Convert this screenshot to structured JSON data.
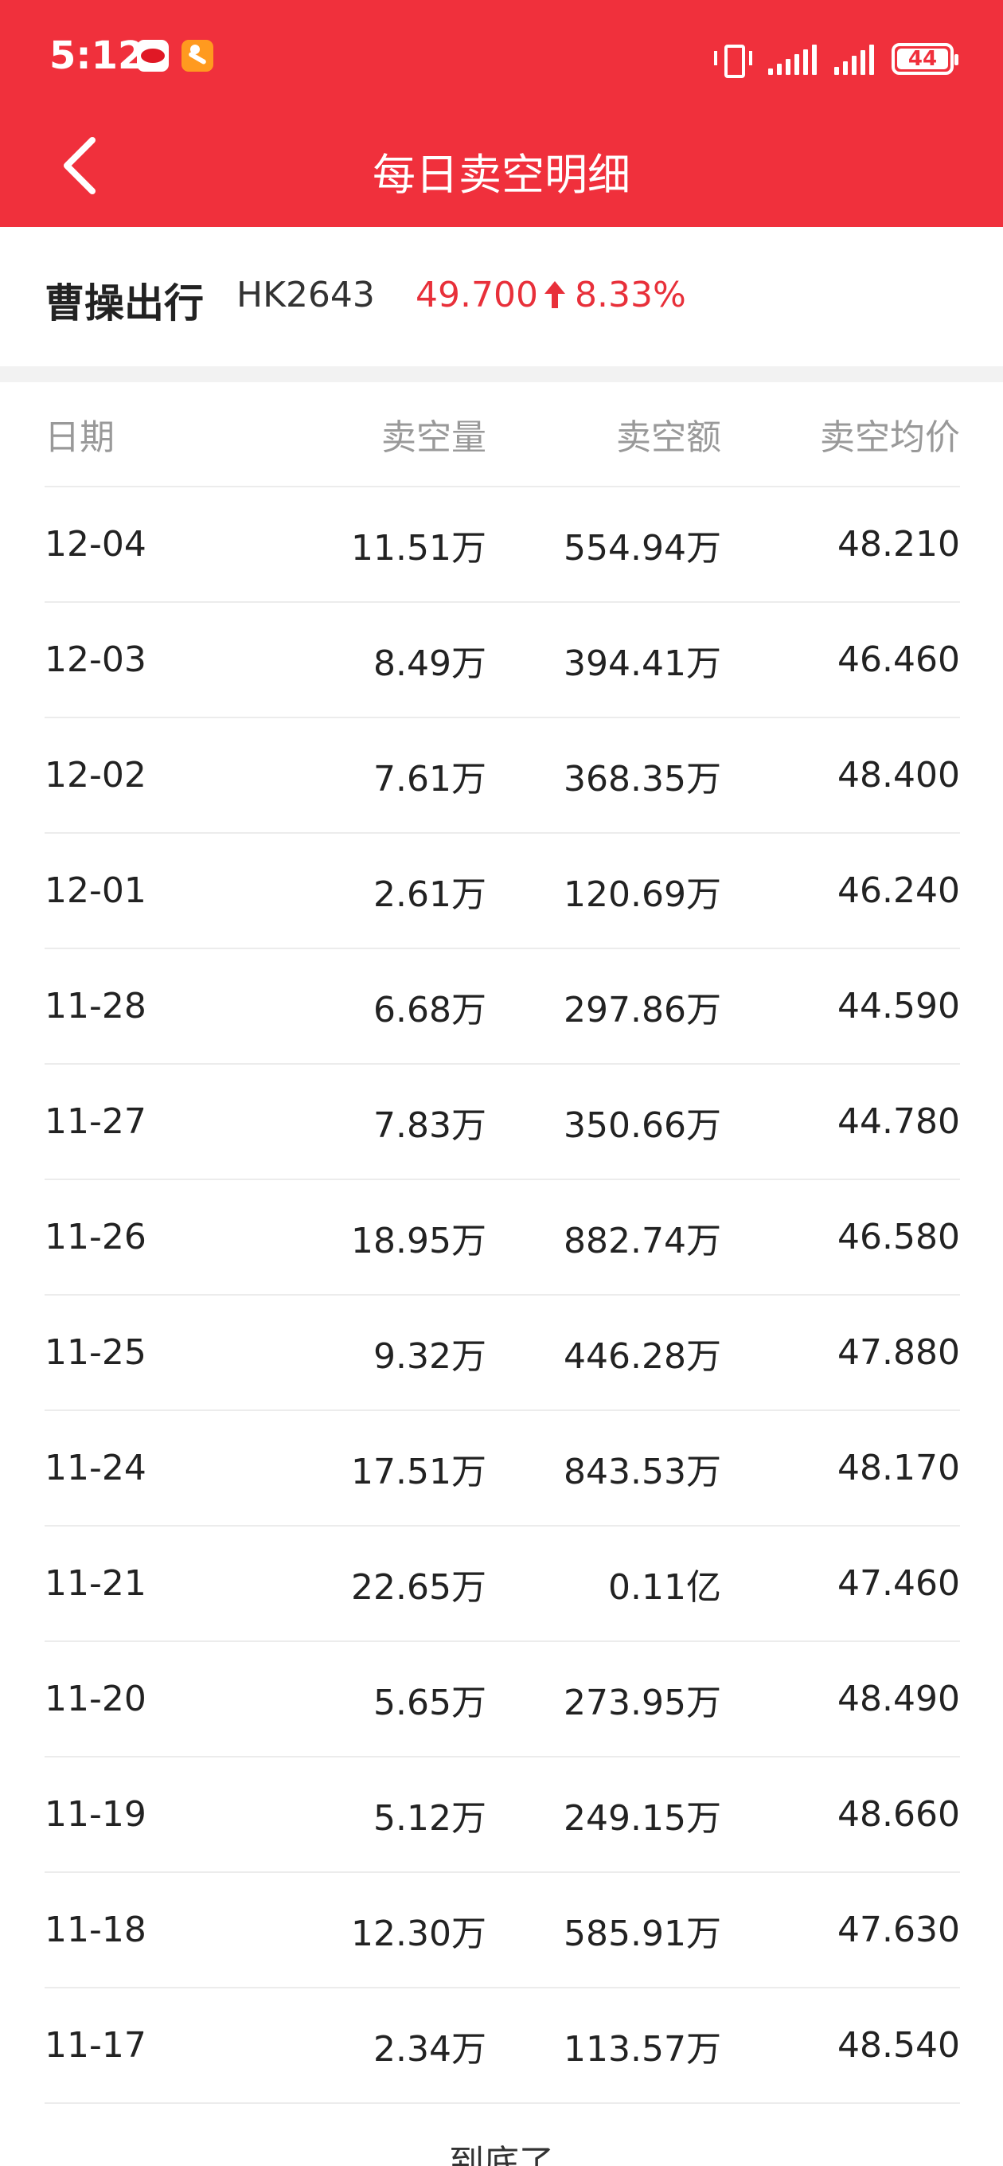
{
  "status_bar": {
    "time": "5:12",
    "battery": "44",
    "app_icons": [
      "byd-icon",
      "cc-app-icon"
    ]
  },
  "header": {
    "title": "每日卖空明细",
    "back_icon": "chevron-left-icon",
    "bg_color": "#f0303c"
  },
  "stock": {
    "name": "曹操出行",
    "code": "HK2643",
    "price": "49.700",
    "change": "8.33%",
    "direction_icon": "arrow-up-icon",
    "up_color": "#e8303a"
  },
  "table": {
    "headers": [
      "日期",
      "卖空量",
      "卖空额",
      "卖空均价"
    ],
    "rows": [
      [
        "12-04",
        "11.51万",
        "554.94万",
        "48.210"
      ],
      [
        "12-03",
        "8.49万",
        "394.41万",
        "46.460"
      ],
      [
        "12-02",
        "7.61万",
        "368.35万",
        "48.400"
      ],
      [
        "12-01",
        "2.61万",
        "120.69万",
        "46.240"
      ],
      [
        "11-28",
        "6.68万",
        "297.86万",
        "44.590"
      ],
      [
        "11-27",
        "7.83万",
        "350.66万",
        "44.780"
      ],
      [
        "11-26",
        "18.95万",
        "882.74万",
        "46.580"
      ],
      [
        "11-25",
        "9.32万",
        "446.28万",
        "47.880"
      ],
      [
        "11-24",
        "17.51万",
        "843.53万",
        "48.170"
      ],
      [
        "11-21",
        "22.65万",
        "0.11亿",
        "47.460"
      ],
      [
        "11-20",
        "5.65万",
        "273.95万",
        "48.490"
      ],
      [
        "11-19",
        "5.12万",
        "249.15万",
        "48.660"
      ],
      [
        "11-18",
        "12.30万",
        "585.91万",
        "47.630"
      ],
      [
        "11-17",
        "2.34万",
        "113.57万",
        "48.540"
      ]
    ]
  },
  "footer": {
    "text": "到底了"
  }
}
